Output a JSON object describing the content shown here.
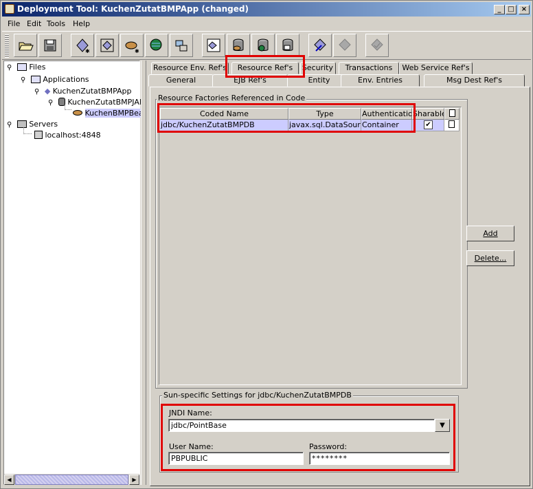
{
  "window": {
    "title": "Deployment Tool: KuchenZutatBMPApp (changed)",
    "minimize": "_",
    "maximize": "□",
    "close": "×"
  },
  "menu": [
    "File",
    "Edit",
    "Tools",
    "Help"
  ],
  "toolbar_icons": [
    "open-folder-icon",
    "save-icon",
    "new-application-icon",
    "new-module-icon",
    "new-bean-icon",
    "new-web-icon",
    "new-client-icon",
    "add-component-icon",
    "db-add-icon",
    "db-tools-icon",
    "db-deploy-icon",
    "deploy-icon",
    "undeploy-icon",
    "verify-icon"
  ],
  "tree": {
    "files": "Files",
    "applications": "Applications",
    "app": "KuchenZutatBMPApp",
    "jar": "KuchenZutatBMPJAR",
    "bean": "KuchenBMPBean",
    "servers": "Servers",
    "localhost": "localhost:4848"
  },
  "tabs_row1": [
    "Resource Env. Ref's",
    "Resource Ref's",
    "Security",
    "Transactions",
    "Web Service Ref's"
  ],
  "tabs_row2": [
    "General",
    "EJB Ref's",
    "Entity",
    "Env. Entries",
    "Msg Dest Ref's"
  ],
  "factories": {
    "title": "Resource Factories Referenced in Code",
    "columns": [
      "Coded Name",
      "Type",
      "Authentication",
      "Sharable"
    ],
    "rows": [
      {
        "coded_name": "jdbc/KuchenZutatBMPDB",
        "type": "javax.sql.DataSource",
        "auth": "Container",
        "sharable": true
      }
    ],
    "add": "Add",
    "delete": "Delete..."
  },
  "sun": {
    "title": "Sun-specific Settings for jdbc/KuchenZutatBMPDB",
    "jndi_label": "JNDI Name:",
    "jndi_value": "jdbc/PointBase",
    "user_label": "User Name:",
    "user_value": "PBPUBLIC",
    "pass_label": "Password:",
    "pass_value": "********"
  },
  "colors": {
    "highlight": "#e00000",
    "selection": "#ccccff",
    "title_start": "#0a246a",
    "title_end": "#a6caf0"
  }
}
